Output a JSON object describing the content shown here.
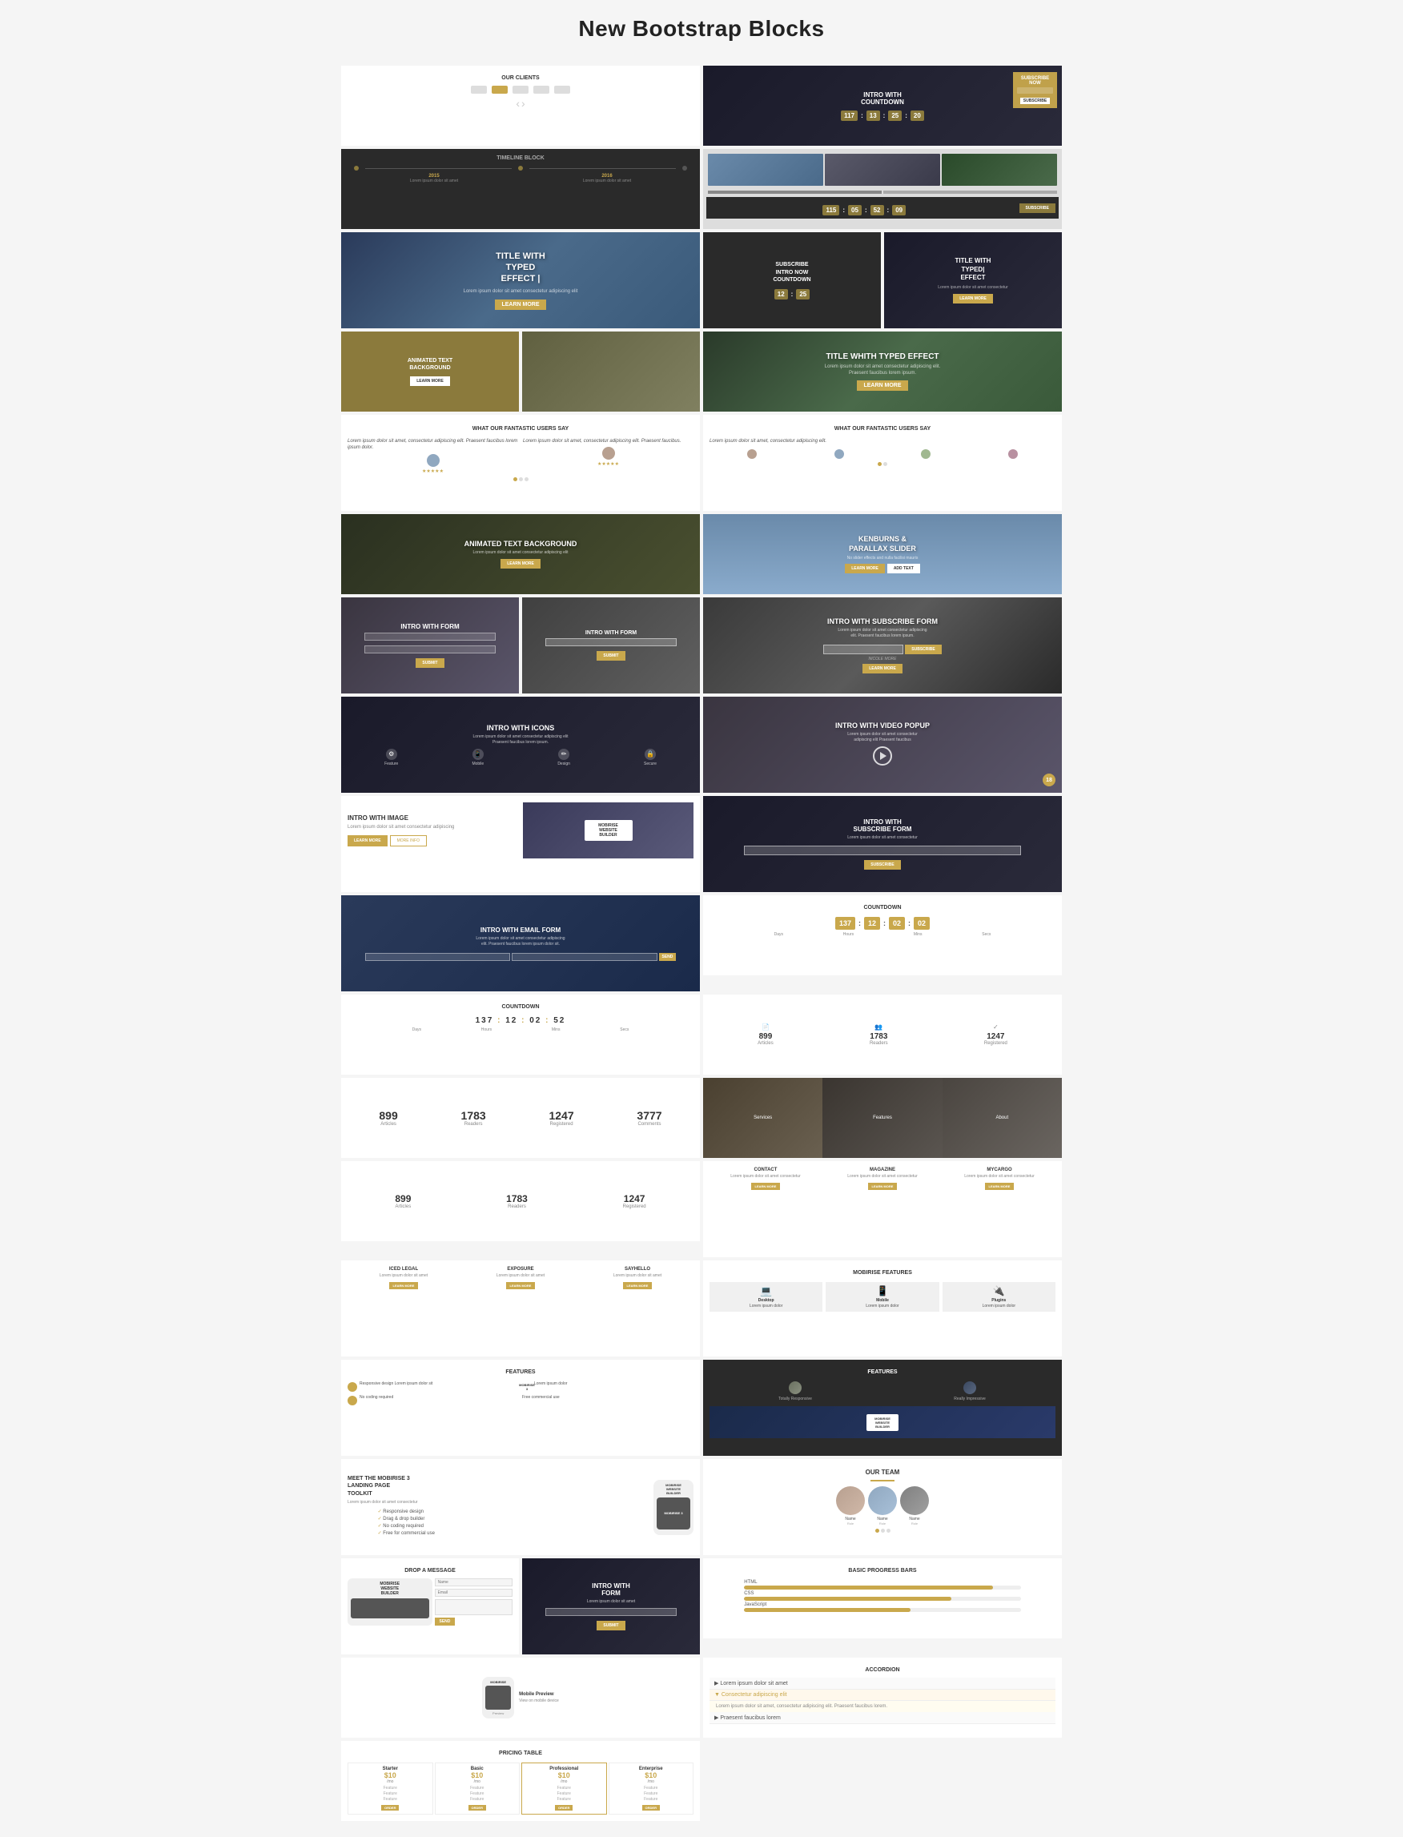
{
  "page": {
    "title": "New Bootstrap Blocks"
  },
  "blocks": [
    {
      "id": "our-clients",
      "label": "OUR CLIENTS",
      "type": "white",
      "size": "span2 h2"
    },
    {
      "id": "intro-countdown",
      "label": "INTRO WITH COUNTDOWN",
      "type": "dark",
      "size": "span2 h2"
    },
    {
      "id": "timeline",
      "label": "TIMELINE BLOCK",
      "type": "dark",
      "size": "span2 h2"
    },
    {
      "id": "photo-right",
      "label": "",
      "type": "photo",
      "size": "span2 h2"
    },
    {
      "id": "title-typed-1",
      "label": "TITLE WITH TYPED EFFECT",
      "type": "mountain",
      "size": "span2 h3"
    },
    {
      "id": "subscribe-intro",
      "label": "subscribe INTRO Now COUNTDOWN",
      "type": "dark",
      "size": "span1 h3"
    },
    {
      "id": "title-typed-2",
      "label": "TITLE WITH TYPED EFFECT",
      "type": "dark",
      "size": "span1 h3"
    },
    {
      "id": "animated-text-1",
      "label": "ANIMATED TEXT BACKGROUND",
      "type": "olive",
      "size": "span1 h2"
    },
    {
      "id": "photo-1",
      "label": "",
      "type": "photo-workspace",
      "size": "span1 h2"
    },
    {
      "id": "title-typed-large",
      "label": "TITLE WHITH TYPED EFFECT",
      "type": "forest",
      "size": "span2 h2"
    },
    {
      "id": "testimonials-1",
      "label": "WHAT OUR FANTASTIC USERS SAY",
      "type": "white",
      "size": "span2 h3"
    },
    {
      "id": "testimonials-2",
      "label": "WHAT OUR FANTASTIC USERS SAY",
      "type": "white",
      "size": "span2 h3"
    },
    {
      "id": "animated-text-2",
      "label": "ANIMATED TEXT BACKGROUND",
      "type": "forest-dark",
      "size": "span2 h2"
    },
    {
      "id": "kenburns",
      "label": "KENBURNS & PARALLAX SLIDER",
      "type": "sky-dark",
      "size": "span2 h2"
    },
    {
      "id": "intro-form-1",
      "label": "INTRO WITH FORM",
      "type": "dark-overlay",
      "size": "span1 h3"
    },
    {
      "id": "intro-form-2",
      "label": "INTRO WITH FORM",
      "type": "photo-phone",
      "size": "span1 h3"
    },
    {
      "id": "intro-subscribe-form",
      "label": "INTRO With SUBSCRIBE FORM",
      "type": "keyboard-dark",
      "size": "span2 h3"
    },
    {
      "id": "intro-icons",
      "label": "INTRO WITH ICONS",
      "type": "keyboard-desk",
      "size": "span2 h3"
    },
    {
      "id": "intro-video-popup",
      "label": "INTRO WITH VIDEO POPUP",
      "type": "photo-laptop",
      "size": "span2 h3"
    },
    {
      "id": "intro-image",
      "label": "INTRO WITH IMAGE",
      "type": "white",
      "size": "span2 h3"
    },
    {
      "id": "intro-subscribe-form-2",
      "label": "INTRO WITH SUBSCRIBE FORM",
      "type": "photo-dark",
      "size": "span2 h3"
    },
    {
      "id": "intro-email-form",
      "label": "INTRO WITH EMAIL FORM",
      "type": "photo-dark2",
      "size": "span2 h3"
    },
    {
      "id": "countdown-1",
      "label": "COUNTDOWN",
      "type": "white",
      "size": "span2 h2",
      "nums": [
        "137",
        "12",
        "02",
        "02"
      ]
    },
    {
      "id": "countdown-2",
      "label": "COUNTDOWN",
      "type": "white",
      "size": "span2 h2",
      "nums": [
        "137",
        "12",
        "02",
        "52"
      ]
    },
    {
      "id": "stats-icons",
      "label": "",
      "type": "white",
      "size": "span2 h2"
    },
    {
      "id": "stats-numbers",
      "label": "",
      "type": "white",
      "size": "span2 h2"
    },
    {
      "id": "photo-thumbs",
      "label": "",
      "type": "white",
      "size": "span2 h2"
    },
    {
      "id": "stats-large",
      "label": "",
      "type": "white",
      "size": "span2 h2"
    },
    {
      "id": "features-1",
      "label": "FEATURES",
      "type": "dark",
      "size": "span2 h3"
    },
    {
      "id": "features-mobirise",
      "label": "MEET THE MOBIRISE 3 LANDING PAGE TOOLKIT",
      "type": "white",
      "size": "span2 h3"
    },
    {
      "id": "services-1",
      "label": "",
      "type": "white",
      "size": "span2 h3"
    },
    {
      "id": "services-2",
      "label": "",
      "type": "white",
      "size": "span2 h3"
    },
    {
      "id": "mobirise-features",
      "label": "MOBIRISE FEATURES",
      "type": "white",
      "size": "span2 h3"
    },
    {
      "id": "features-2",
      "label": "FEATURES",
      "type": "white",
      "size": "span2 h3"
    },
    {
      "id": "our-team",
      "label": "OUR TEAM",
      "type": "white",
      "size": "span2 h3"
    },
    {
      "id": "drop-message",
      "label": "DROP A MESSAGE",
      "type": "white",
      "size": "span1 h3"
    },
    {
      "id": "intro-form-dark",
      "label": "INTRO WITH FORM",
      "type": "dark-photo",
      "size": "span1 h3"
    },
    {
      "id": "basic-progress",
      "label": "Basic Progress Bars",
      "type": "white",
      "size": "span2 h2"
    },
    {
      "id": "mobile-preview",
      "label": "",
      "type": "white",
      "size": "span1 h2"
    },
    {
      "id": "pricing-table",
      "label": "PRICING TABLE",
      "type": "white",
      "size": "span2 h3"
    },
    {
      "id": "accordion",
      "label": "Accordion",
      "type": "white",
      "size": "span2 h2"
    }
  ],
  "stats": {
    "row1": [
      {
        "num": "899",
        "label": "Articles"
      },
      {
        "num": "1783",
        "label": "Readers"
      },
      {
        "num": "1247",
        "label": "Registered"
      },
      {
        "num": "3777",
        "label": "Comments"
      }
    ],
    "row2": [
      {
        "num": "899",
        "label": "Articles"
      },
      {
        "num": "1783",
        "label": "Readers"
      },
      {
        "num": "1247",
        "label": "Registered"
      }
    ],
    "row3": [
      {
        "num": "899",
        "label": "Articles"
      },
      {
        "num": "1783",
        "label": "Readers"
      },
      {
        "num": "1247",
        "label": "Registered"
      }
    ]
  },
  "countdown1": {
    "nums": [
      "137",
      "12",
      "02",
      "02"
    ],
    "labels": [
      "Days",
      "Hours",
      "Mins",
      "Secs"
    ]
  },
  "countdown2": {
    "nums": [
      "137",
      "12",
      "02",
      "52"
    ],
    "labels": [
      "Days",
      "Hours",
      "Mins",
      "Secs"
    ]
  },
  "countdown_large": {
    "nums": [
      "117",
      "13",
      "25",
      "20"
    ]
  },
  "countdown_header": {
    "nums": [
      "115",
      "05",
      "52",
      "09"
    ]
  },
  "pricing": [
    {
      "tier": "Starter",
      "price": "$10",
      "period": "/mo"
    },
    {
      "tier": "Basic",
      "price": "$10",
      "period": "/mo"
    },
    {
      "tier": "Professional",
      "price": "$10",
      "period": "/mo"
    },
    {
      "tier": "Enterprise",
      "price": "$10",
      "period": "/mo"
    }
  ],
  "team_members": [
    {
      "name": "Name",
      "role": "Role"
    },
    {
      "name": "Name",
      "role": "Role"
    },
    {
      "name": "Name",
      "role": "Role"
    }
  ],
  "progress_bars": [
    {
      "label": "HTML",
      "pct": 90
    },
    {
      "label": "CSS",
      "pct": 75
    },
    {
      "label": "JavaScript",
      "pct": 60
    }
  ],
  "features_list": [
    "Responsive design",
    "Drag & drop builder",
    "No coding required",
    "Free for commercial use"
  ],
  "mobirise_label": "MOBIRISE WEBSITE BUILDER"
}
